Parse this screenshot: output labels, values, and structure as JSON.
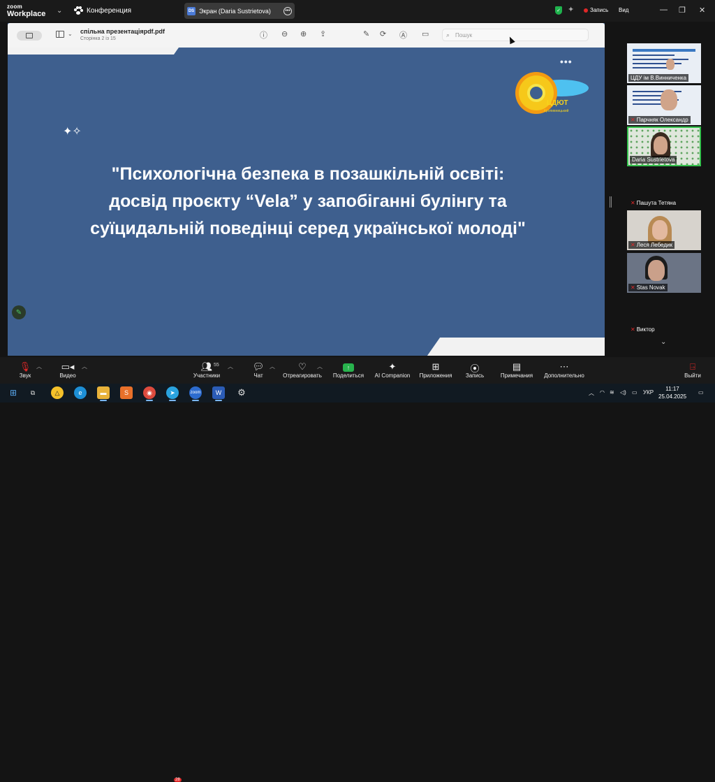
{
  "app": {
    "logo_line1": "zoom",
    "logo_line2": "Workplace"
  },
  "topbar": {
    "meeting_label": "Конференция",
    "share_tab": {
      "initials": "DS",
      "label": "Экран (Daria Sustrietova)"
    },
    "record_label": "Запись",
    "view_label": "Вид",
    "shield_color": "#1fb34d"
  },
  "pdf_viewer": {
    "file_name": "спільна презентаціяpdf.pdf",
    "page_info": "Сторінка 2 із 15",
    "search_placeholder": "Пошук",
    "tools": [
      "info-icon",
      "zoom-out-icon",
      "zoom-in-icon",
      "share-icon",
      "markup-icon",
      "rotate-icon",
      "annotate-icon",
      "form-icon"
    ]
  },
  "slide": {
    "background": "#3e5f8e",
    "logo_text": "ЦДЮТ",
    "logo_sub": "Кропивницький",
    "title_line1": "\"Психологічна безпека в позашкільній освіті:",
    "title_line2": "досвід проєкту “Vela” у запобіганні булінгу та",
    "title_line3": "суїцидальній поведінці серед української молоді\""
  },
  "participants": [
    {
      "name": "ЦДУ ім В.Винниченка",
      "muted": false
    },
    {
      "name": "Парчняк Олександр",
      "muted": true
    },
    {
      "name": "Daria Sustrietova",
      "muted": false,
      "active": true
    },
    {
      "name": "Пашута Тетяна",
      "muted": true
    },
    {
      "name": "Леся Лебедик",
      "muted": true
    },
    {
      "name": "Stas Novak",
      "muted": true
    },
    {
      "name": "Виктор",
      "muted": true
    }
  ],
  "toolbar": {
    "audio": "Звук",
    "video": "Видео",
    "participants": "Участники",
    "participants_count": "55",
    "chat": "Чат",
    "react": "Отреагировать",
    "share": "Поделиться",
    "ai": "AI Companion",
    "apps": "Приложения",
    "record": "Запись",
    "notes": "Примечания",
    "more": "Дополнительно",
    "leave": "Выйти"
  },
  "taskbar": {
    "lang": "УКР",
    "time": "11:17",
    "date": "25.04.2025",
    "telegram_badge": "28"
  }
}
